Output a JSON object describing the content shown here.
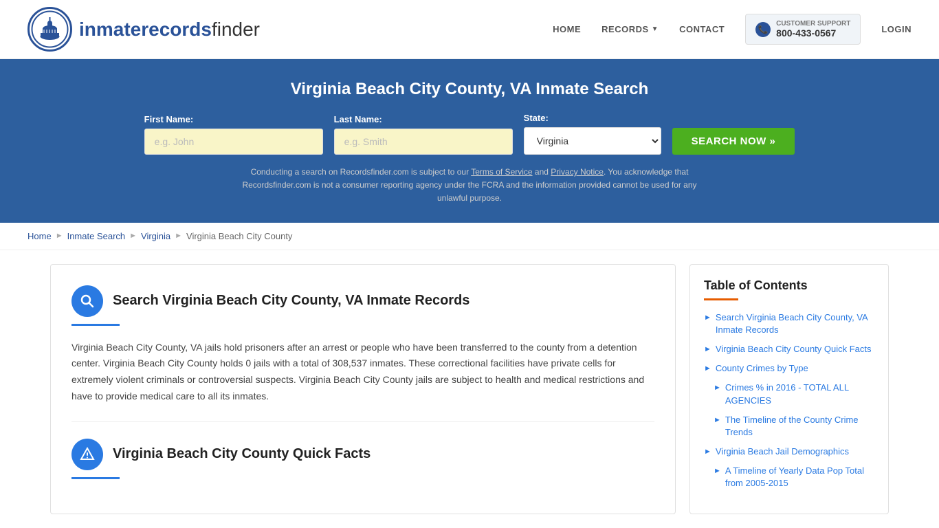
{
  "header": {
    "logo_text_regular": "inmaterecords",
    "logo_text_bold": "finder",
    "nav": {
      "home": "HOME",
      "records": "RECORDS",
      "contact": "CONTACT",
      "login": "LOGIN"
    },
    "support": {
      "label": "CUSTOMER SUPPORT",
      "phone": "800-433-0567"
    }
  },
  "search_banner": {
    "title": "Virginia Beach City County, VA Inmate Search",
    "first_name_label": "First Name:",
    "first_name_placeholder": "e.g. John",
    "last_name_label": "Last Name:",
    "last_name_placeholder": "e.g. Smith",
    "state_label": "State:",
    "state_value": "Virginia",
    "search_button": "SEARCH NOW »",
    "disclaimer": "Conducting a search on Recordsfinder.com is subject to our Terms of Service and Privacy Notice. You acknowledge that Recordsfinder.com is not a consumer reporting agency under the FCRA and the information provided cannot be used for any unlawful purpose."
  },
  "breadcrumb": {
    "items": [
      "Home",
      "Inmate Search",
      "Virginia",
      "Virginia Beach City County"
    ]
  },
  "main": {
    "section1": {
      "title": "Search Virginia Beach City County, VA Inmate Records",
      "body": "Virginia Beach City County, VA jails hold prisoners after an arrest or people who have been transferred to the county from a detention center. Virginia Beach City County holds 0 jails with a total of 308,537 inmates. These correctional facilities have private cells for extremely violent criminals or controversial suspects. Virginia Beach City County jails are subject to health and medical restrictions and have to provide medical care to all its inmates."
    },
    "section2": {
      "title": "Virginia Beach City County Quick Facts"
    }
  },
  "sidebar": {
    "toc_title": "Table of Contents",
    "items": [
      {
        "label": "Search Virginia Beach City County, VA Inmate Records",
        "sub": false
      },
      {
        "label": "Virginia Beach City County Quick Facts",
        "sub": false
      },
      {
        "label": "County Crimes by Type",
        "sub": false
      },
      {
        "label": "Crimes % in 2016 - TOTAL ALL AGENCIES",
        "sub": true
      },
      {
        "label": "The Timeline of the County Crime Trends",
        "sub": true
      },
      {
        "label": "Virginia Beach Jail Demographics",
        "sub": false
      },
      {
        "label": "A Timeline of Yearly Data Pop Total from 2005-2015",
        "sub": true
      }
    ]
  }
}
